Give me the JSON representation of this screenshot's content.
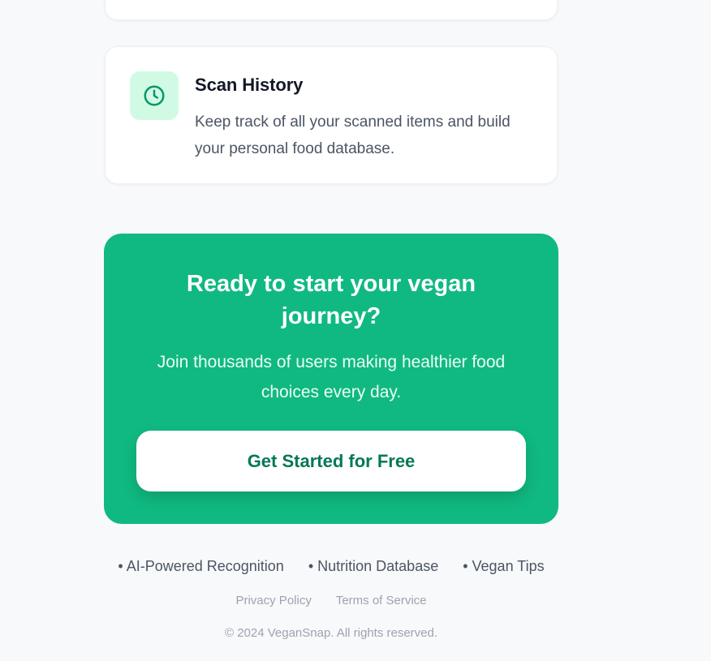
{
  "feature": {
    "title": "Scan History",
    "description": "Keep track of all your scanned items and build your personal food database."
  },
  "cta": {
    "title": "Ready to start your vegan journey?",
    "subtitle": "Join thousands of users making healthier food choices every day.",
    "button_label": "Get Started for Free"
  },
  "footer": {
    "features": [
      "• AI-Powered Recognition",
      "• Nutrition Database",
      "• Vegan Tips"
    ],
    "links": [
      "Privacy Policy",
      "Terms of Service"
    ],
    "copyright": "© 2024 VeganSnap. All rights reserved."
  },
  "colors": {
    "accent": "#10b981",
    "icon_bg": "#d1fae5",
    "icon_stroke": "#059669",
    "button_text": "#047857"
  },
  "icons": {
    "feature": "clock-icon"
  }
}
